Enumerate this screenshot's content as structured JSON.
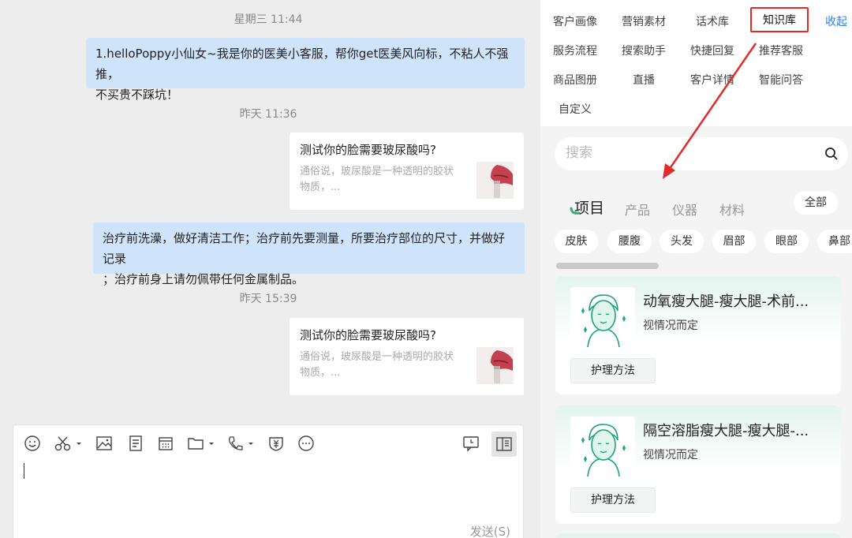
{
  "chat": {
    "messages": [
      {
        "timestamp": "星期三 11:44",
        "type": "text",
        "text": "1.helloPoppy小仙女~我是你的医美小客服，帮你get医美风向标，不粘人不强推，不买贵不踩坑！"
      },
      {
        "timestamp": "昨天 11:36",
        "type": "card",
        "title": "测试你的脸需要玻尿酸吗?",
        "desc": "通俗说，玻尿酸是一种透明的胶状物质，..."
      },
      {
        "type": "text",
        "text": "治疗前洗澡，做好清洁工作；治疗前先要测量，如果要治疗部位的尺寸，并做好记录；治疗前身上请勿佩带任何金属制品。"
      },
      {
        "timestamp": "昨天 15:39",
        "type": "card",
        "title": "测试你的脸需要玻尿酸吗?",
        "desc": "通俗说，玻尿酸是一种透明的胶状物质，..."
      }
    ],
    "msg1_line1": "1.helloPoppy小仙女~我是你的医美小客服，帮你get医美风向标，不粘人不强推，",
    "msg1_line2": "不买贵不踩坑！",
    "msg3_line1": "治疗前洗澡，做好清洁工作；治疗前先要测量，所要治疗部位的尺寸，并做好记录",
    "msg3_line2": "；治疗前身上请勿佩带任何金属制品。",
    "card_desc_line1": "通俗说，玻尿酸是一种透明的胶状",
    "card_desc_line2": "物质，...",
    "send_label": "发送(S)"
  },
  "menu": {
    "row1": [
      "客户画像",
      "营销素材",
      "话术库",
      "知识库"
    ],
    "collapse_label": "收起",
    "row2": [
      "服务流程",
      "搜索助手",
      "快捷回复",
      "推荐客服"
    ],
    "row3": [
      "商品图册",
      "直播",
      "客户详情",
      "智能问答"
    ],
    "row4": [
      "自定义"
    ]
  },
  "search": {
    "placeholder": "搜索"
  },
  "tabs": [
    "项目",
    "产品",
    "仪器",
    "材料"
  ],
  "all_label": "全部",
  "chips": [
    "皮肤",
    "腰腹",
    "头发",
    "眉部",
    "眼部",
    "鼻部"
  ],
  "knowledge_items": [
    {
      "title": "动氧瘦大腿-瘦大腿-术前...",
      "subtitle": "视情况而定",
      "button": "护理方法"
    },
    {
      "title": "隔空溶脂瘦大腿-瘦大腿-...",
      "subtitle": "视情况而定",
      "button": "护理方法"
    }
  ],
  "colors": {
    "highlight": "#e22a2a",
    "bubble": "#cfe3fb",
    "accent": "#2d7cf6",
    "card_tint": "#e3f4ee"
  }
}
